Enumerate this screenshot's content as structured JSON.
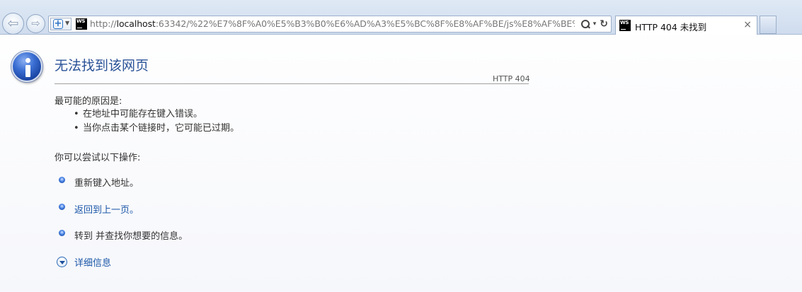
{
  "browser": {
    "url_prefix": "http://",
    "url_host": "localhost",
    "url_rest": ":63342/%22%E7%8F%A0%E5%B3%B0%E6%AD%A3%E5%BC%8F%E8%AF%BE/js%E8%AF%BE%E7%A8%",
    "tab_title": "HTTP 404 未找到",
    "tab_close": "×",
    "site_icon_text": "WS",
    "back_glyph": "⇦",
    "forward_glyph": "⇨"
  },
  "page": {
    "title": "无法找到该网页",
    "http_code": "HTTP 404",
    "reason_heading": "最可能的原因是:",
    "reasons": [
      "在地址中可能存在键入错误。",
      "当你点击某个链接时，它可能已过期。"
    ],
    "try_heading": "你可以尝试以下操作:",
    "actions": [
      {
        "text": "重新键入地址。",
        "is_link": false
      },
      {
        "text": "返回到上一页。",
        "is_link": true
      },
      {
        "text": "转到  并查找你想要的信息。",
        "is_link": false
      }
    ],
    "details_label": "详细信息"
  },
  "colors": {
    "title": "#2a5297",
    "link": "#1b57a8",
    "chrome_bg": "#d6e2f1"
  },
  "icons": [
    "info-icon",
    "back-arrow-icon",
    "forward-arrow-icon",
    "compatibility-view-icon",
    "webstorm-icon",
    "search-icon",
    "refresh-icon",
    "close-icon",
    "blue-bullet-icon",
    "expand-chevron-icon"
  ]
}
